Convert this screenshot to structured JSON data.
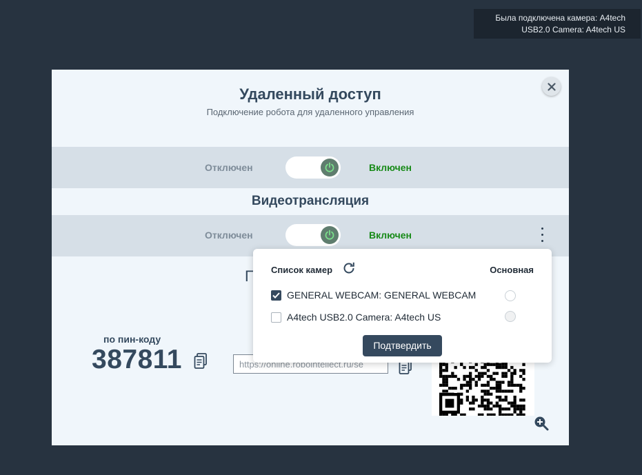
{
  "toast": {
    "line1": "Была подключена камера: A4tech",
    "line2": "USB2.0 Camera: A4tech US"
  },
  "modal": {
    "title": "Удаленный доступ",
    "subtitle": "Подключение робота для удаленного управления",
    "remote_toggle": {
      "off_label": "Отключен",
      "on_label": "Включен",
      "state": "on"
    },
    "video_section_title": "Видеотрансляция",
    "video_toggle": {
      "off_label": "Отключен",
      "on_label": "Включен",
      "state": "on"
    },
    "hidden_heading_fragment": "П",
    "pin": {
      "label": "по пин-коду",
      "code": "387811"
    },
    "url_input": {
      "value": "https://online.robointellect.ru/se"
    }
  },
  "camera_popup": {
    "title": "Список камер",
    "main_column_label": "Основная",
    "cameras": [
      {
        "label": "GENERAL WEBCAM: GENERAL WEBCAM",
        "checked": true
      },
      {
        "label": "A4tech USB2.0 Camera: A4tech US",
        "checked": false
      }
    ],
    "confirm_label": "Подтвердить"
  },
  "icons": {
    "close": "close-icon",
    "power": "power-icon",
    "kebab": "kebab-menu-icon",
    "refresh": "refresh-icon",
    "copy": "copy-icon",
    "zoom": "zoom-in-icon",
    "qr": "qr-code"
  },
  "colors": {
    "background": "#273340",
    "accent": "#35495e",
    "on_green": "#178a17",
    "knob": "#5f7d6e"
  }
}
